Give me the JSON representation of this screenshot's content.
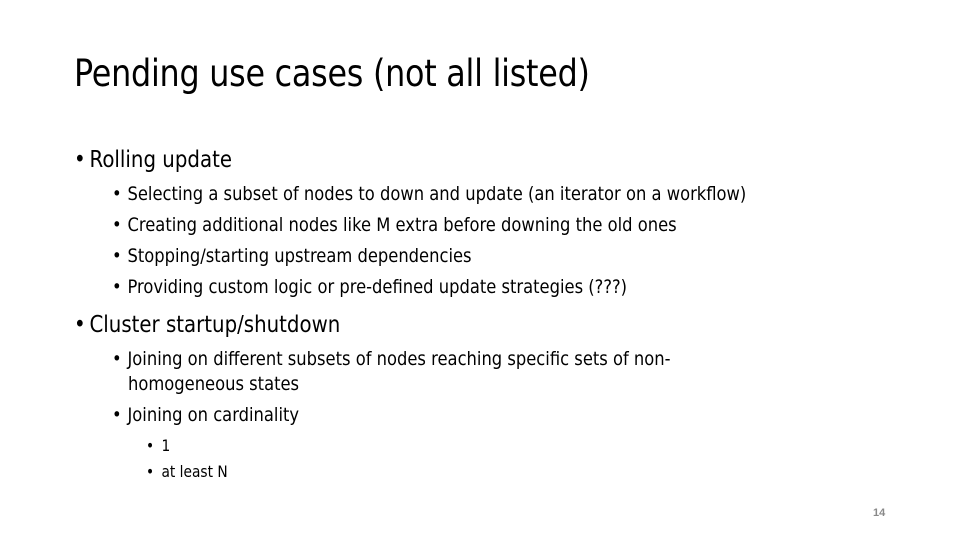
{
  "slide": {
    "title": "Pending use cases (not all listed)",
    "bullet_char": "•",
    "sections": [
      {
        "label": "Rolling update",
        "items": [
          "Selecting a subset of nodes to down and update (an iterator on a workflow)",
          "Creating additional nodes like M extra before downing the old ones",
          "Stopping/starting upstream dependencies",
          "Providing custom logic or pre-defined update strategies (???)"
        ]
      },
      {
        "label": "Cluster startup/shutdown",
        "items": [
          {
            "line1": "Joining on different subsets of nodes reaching specific sets of non-",
            "line2": "homogeneous states"
          },
          {
            "line1": "Joining on cardinality",
            "subitems": [
              "1",
              "at least N"
            ]
          }
        ]
      }
    ],
    "page_number": "14"
  }
}
